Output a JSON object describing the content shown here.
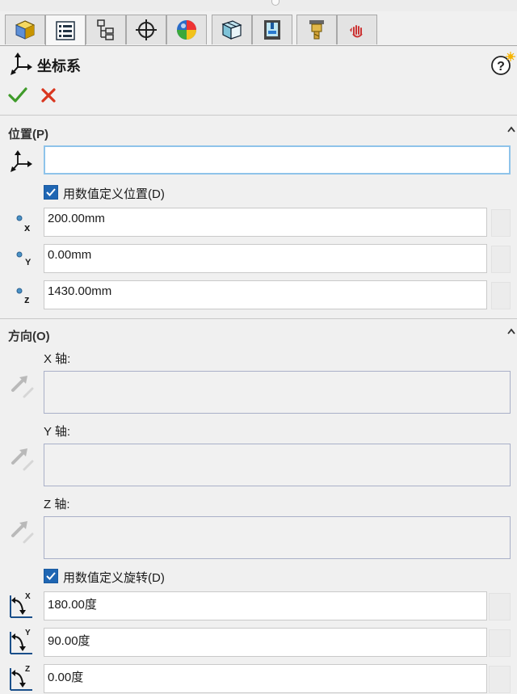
{
  "tabs": [
    {
      "name": "feature-manager",
      "icon": "part-feature-icon"
    },
    {
      "name": "property-manager",
      "icon": "property-manager-icon"
    },
    {
      "name": "configuration-manager",
      "icon": "configuration-manager-icon"
    },
    {
      "name": "dimxpert-manager",
      "icon": "crosshair-target-icon"
    },
    {
      "name": "display-manager",
      "icon": "appearance-sphere-icon"
    },
    {
      "name": "tab-6",
      "icon": "cube-layers-icon"
    },
    {
      "name": "tab-7",
      "icon": "machine-station-icon"
    },
    {
      "name": "tab-8",
      "icon": "drill-tool-icon"
    },
    {
      "name": "tab-9",
      "icon": "hand-icon"
    }
  ],
  "panel": {
    "title": "坐标系",
    "help_icon": "help-question-icon"
  },
  "position": {
    "header": "位置(P)",
    "origin_value": "",
    "numeric_checkbox_label": "用数值定义位置(D)",
    "numeric_checked": true,
    "x_label": "x",
    "y_label": "Y",
    "z_label": "z",
    "x_value": "200.00mm",
    "y_value": "0.00mm",
    "z_value": "1430.00mm"
  },
  "orientation": {
    "header": "方向(O)",
    "x_axis_label": "X 轴:",
    "y_axis_label": "Y 轴:",
    "z_axis_label": "Z 轴:",
    "numeric_rotation_label": "用数值定义旋转(D)",
    "numeric_rotation_checked": true,
    "rx_label": "X",
    "ry_label": "Y",
    "rz_label": "Z",
    "rx_value": "180.00度",
    "ry_value": "90.00度",
    "rz_value": "0.00度"
  },
  "colors": {
    "accent": "#1f66b3",
    "ok": "#3f9b2a",
    "cancel": "#d9361e",
    "selected_border": "#8ec3ea"
  }
}
